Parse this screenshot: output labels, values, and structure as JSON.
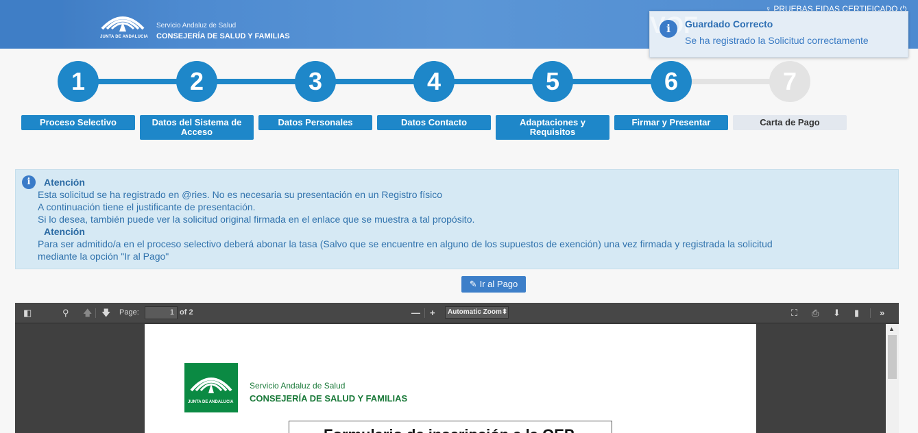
{
  "header": {
    "logo_caption": "JUNTA DE ANDALUCIA",
    "org_line1": "Servicio Andaluz de Salud",
    "org_line2": "CONSEJERÍA DE SALUD Y FAMILIAS",
    "user_label": "PRUEBAS EIDAS CERTIFICADO"
  },
  "toast": {
    "title": "Guardado Correcto",
    "message": "Se ha registrado la Solicitud correctamente"
  },
  "steps": [
    {
      "number": "1",
      "label": "Proceso Selectivo",
      "active": true
    },
    {
      "number": "2",
      "label": "Datos del Sistema de Acceso",
      "active": true
    },
    {
      "number": "3",
      "label": "Datos Personales",
      "active": true
    },
    {
      "number": "4",
      "label": "Datos Contacto",
      "active": true
    },
    {
      "number": "5",
      "label": "Adaptaciones y Requisitos",
      "active": true
    },
    {
      "number": "6",
      "label": "Firmar y Presentar",
      "active": true
    },
    {
      "number": "7",
      "label": "Carta de Pago",
      "active": false
    }
  ],
  "notice": {
    "title1": "Atención",
    "line1": "Esta solicitud se ha registrado en @ries. No es necesaria su presentación en un Registro físico",
    "line2": "A continuación tiene el justificante de presentación.",
    "line3": "Si lo desea, también puede ver la solicitud original firmada en el enlace que se muestra a tal propósito.",
    "title2": "Atención",
    "line4": "Para ser admitido/a en el proceso selectivo deberá abonar la tasa (Salvo que se encuentre en alguno de los supuestos de exención) una vez firmada y registrada la solicitud",
    "line5": "mediante la opción \"Ir al Pago\""
  },
  "pay_button": {
    "label": "Ir al Pago"
  },
  "viewer": {
    "page_label": "Page:",
    "page_value": "1",
    "page_total": "of 2",
    "zoom": "Automatic Zoom",
    "pdf": {
      "logo_caption": "JUNTA DE ANDALUCIA",
      "org_line1": "Servicio Andaluz de Salud",
      "org_line2": "CONSEJERÍA DE SALUD Y FAMILIAS",
      "title": "Formulario de inscripción a la OEP"
    }
  },
  "colors": {
    "step_active": "#1e87c9",
    "step_inactive": "#e3e3e3",
    "notice_bg": "#d6e9f4",
    "header_blue": "#4d8ad0",
    "pdf_green": "#0b8a43"
  }
}
